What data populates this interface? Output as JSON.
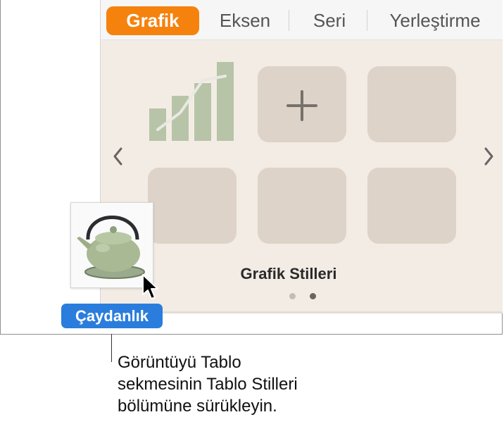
{
  "tabs": [
    {
      "label": "Grafik",
      "active": true
    },
    {
      "label": "Eksen",
      "active": false
    },
    {
      "label": "Seri",
      "active": false
    },
    {
      "label": "Yerleştirme",
      "active": false
    }
  ],
  "panel": {
    "caption": "Grafik Stilleri",
    "page_count": 2,
    "current_page": 2,
    "tile_icons": [
      "bar-chart-icon",
      "plus-icon"
    ]
  },
  "drag_item": {
    "label": "Çaydanlık",
    "image": "teapot-image"
  },
  "callout": {
    "lines": [
      "Görüntüyü Tablo",
      "sekmesinin Tablo Stilleri",
      "bölümüne sürükleyin."
    ]
  },
  "colors": {
    "accent": "#f5820d",
    "badge": "#2a7ddc",
    "panel_bg": "#f3ece4",
    "tile_bg": "#ddd3c9",
    "chart_green": "#b7c4a8"
  }
}
